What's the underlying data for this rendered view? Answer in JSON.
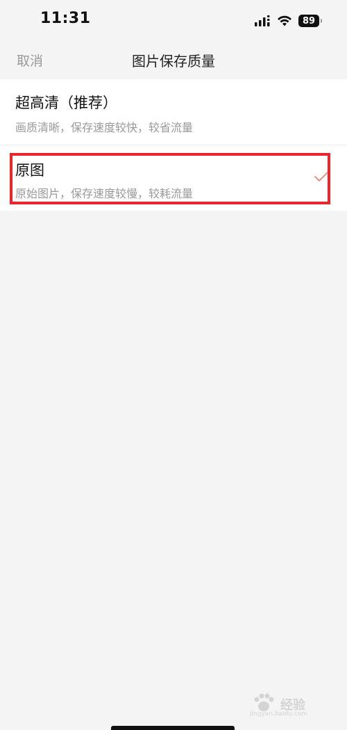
{
  "status_bar": {
    "time": "11:31",
    "battery": "89"
  },
  "nav": {
    "cancel_label": "取消",
    "title": "图片保存质量"
  },
  "options": [
    {
      "title": "超高清（推荐）",
      "description": "画质清晰，保存速度较快，较省流量",
      "selected": false
    },
    {
      "title": "原图",
      "description": "原始图片，保存速度较慢，较耗流量",
      "selected": true
    }
  ],
  "colors": {
    "accent_check": "#f08f84",
    "highlight_border": "#e8262c",
    "background": "#f4f4f4"
  },
  "watermark": {
    "brand": "经验",
    "url": "jingyan.baidu.com"
  }
}
